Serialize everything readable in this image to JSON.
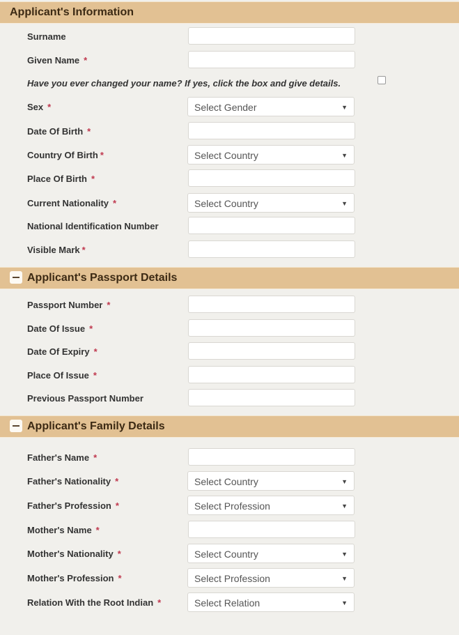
{
  "sections": {
    "info": {
      "title": "Applicant's Information"
    },
    "passport": {
      "title": "Applicant's Passport Details"
    },
    "family": {
      "title": "Applicant's Family Details"
    }
  },
  "info": {
    "surname": "Surname",
    "given_name": "Given Name",
    "name_change_note": "Have you ever changed your name? If yes, click the box and give details.",
    "sex": "Sex",
    "sex_placeholder": "Select Gender",
    "dob": "Date Of Birth",
    "country_of_birth": "Country Of Birth",
    "country_placeholder": "Select Country",
    "place_of_birth": "Place Of Birth",
    "current_nationality": "Current Nationality",
    "national_id": "National Identification Number",
    "visible_mark": "Visible Mark"
  },
  "passport": {
    "number": "Passport Number",
    "date_of_issue": "Date Of Issue",
    "date_of_expiry": "Date Of Expiry",
    "place_of_issue": "Place Of Issue",
    "previous_number": "Previous Passport Number"
  },
  "family": {
    "fathers_name": "Father's Name",
    "fathers_nationality": "Father's Nationality",
    "fathers_profession": "Father's Profession",
    "mothers_name": "Mother's Name",
    "mothers_nationality": "Mother's Nationality",
    "mothers_profession": "Mother's Profession",
    "relation_root_indian": "Relation With the Root Indian",
    "country_placeholder": "Select Country",
    "profession_placeholder": "Select Profession",
    "relation_placeholder": "Select Relation"
  },
  "required_mark": "*",
  "caret": "▼"
}
